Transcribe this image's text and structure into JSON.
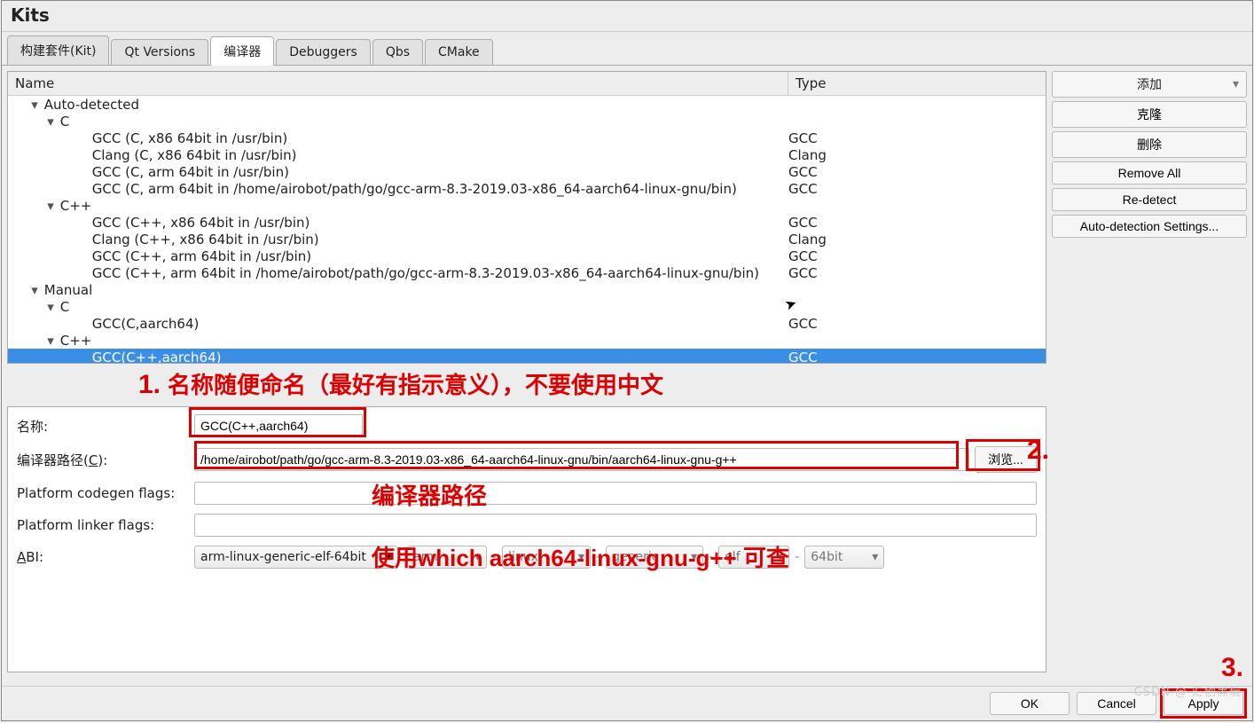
{
  "window": {
    "title": "Kits"
  },
  "tabs": {
    "items": [
      "构建套件(Kit)",
      "Qt Versions",
      "编译器",
      "Debuggers",
      "Qbs",
      "CMake"
    ],
    "active": 2
  },
  "tree": {
    "header_name": "Name",
    "header_type": "Type",
    "rows": [
      {
        "indent": 1,
        "twisty": "▾",
        "name": "Auto-detected",
        "type": ""
      },
      {
        "indent": 2,
        "twisty": "▾",
        "name": "C",
        "type": ""
      },
      {
        "indent": 4,
        "twisty": "",
        "name": "GCC (C, x86 64bit in /usr/bin)",
        "type": "GCC"
      },
      {
        "indent": 4,
        "twisty": "",
        "name": "Clang (C, x86 64bit in /usr/bin)",
        "type": "Clang"
      },
      {
        "indent": 4,
        "twisty": "",
        "name": "GCC (C, arm 64bit in /usr/bin)",
        "type": "GCC"
      },
      {
        "indent": 4,
        "twisty": "",
        "name": "GCC (C, arm 64bit in /home/airobot/path/go/gcc-arm-8.3-2019.03-x86_64-aarch64-linux-gnu/bin)",
        "type": "GCC"
      },
      {
        "indent": 2,
        "twisty": "▾",
        "name": "C++",
        "type": ""
      },
      {
        "indent": 4,
        "twisty": "",
        "name": "GCC (C++, x86 64bit in /usr/bin)",
        "type": "GCC"
      },
      {
        "indent": 4,
        "twisty": "",
        "name": "Clang (C++, x86 64bit in /usr/bin)",
        "type": "Clang"
      },
      {
        "indent": 4,
        "twisty": "",
        "name": "GCC (C++, arm 64bit in /usr/bin)",
        "type": "GCC"
      },
      {
        "indent": 4,
        "twisty": "",
        "name": "GCC (C++, arm 64bit in /home/airobot/path/go/gcc-arm-8.3-2019.03-x86_64-aarch64-linux-gnu/bin)",
        "type": "GCC"
      },
      {
        "indent": 1,
        "twisty": "▾",
        "name": "Manual",
        "type": ""
      },
      {
        "indent": 2,
        "twisty": "▾",
        "name": "C",
        "type": ""
      },
      {
        "indent": 4,
        "twisty": "",
        "name": "GCC(C,aarch64)",
        "type": "GCC"
      },
      {
        "indent": 2,
        "twisty": "▾",
        "name": "C++",
        "type": ""
      },
      {
        "indent": 4,
        "twisty": "",
        "name": "GCC(C++,aarch64)",
        "type": "GCC",
        "selected": true
      }
    ]
  },
  "side_buttons": {
    "add": "添加",
    "clone": "克隆",
    "delete": "删除",
    "remove_all": "Remove All",
    "redetect": "Re-detect",
    "auto_settings": "Auto-detection Settings..."
  },
  "form": {
    "name_label": "名称:",
    "name_value": "GCC(C++,aarch64)",
    "path_label_pre": "编译器路径(",
    "path_label_key": "C",
    "path_label_post": "):",
    "path_value": "/home/airobot/path/go/gcc-arm-8.3-2019.03-x86_64-aarch64-linux-gnu/bin/aarch64-linux-gnu-g++",
    "browse_label": "浏览...",
    "codegen_label": "Platform codegen flags:",
    "codegen_value": "",
    "linker_label": "Platform linker flags:",
    "linker_value": "",
    "abi_label_key": "A",
    "abi_label_rest": "BI:",
    "abi_combo": "arm-linux-generic-elf-64bit",
    "abi_parts": [
      "arm",
      "linux",
      "generic",
      "elf",
      "64bit"
    ]
  },
  "annotations": {
    "a1_num": "1.",
    "a1_text": "名称随便命名（最好有指示意义），不要使用中文",
    "a2_num": "2.",
    "a2_line1": "编译器路径",
    "a2_line2": "使用which aarch64-linux-gnu-g++ 可查",
    "a3_num": "3."
  },
  "footer": {
    "ok": "OK",
    "cancel": "Cancel",
    "apply": "Apply"
  },
  "watermark": "CSDN @ 汇创黑玩"
}
